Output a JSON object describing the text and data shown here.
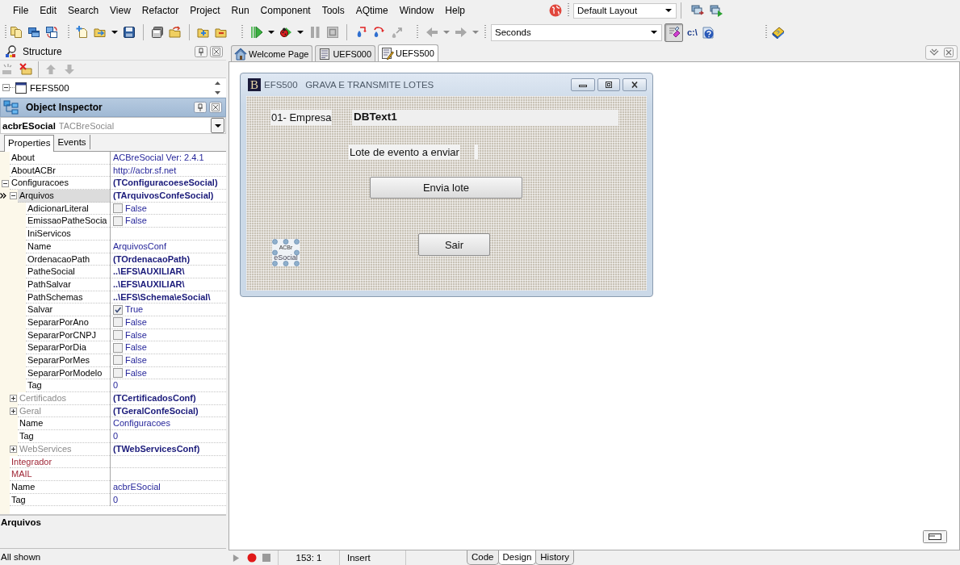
{
  "menu": {
    "items": [
      "File",
      "Edit",
      "Search",
      "View",
      "Refactor",
      "Project",
      "Run",
      "Component",
      "Tools",
      "AQtime",
      "Window",
      "Help"
    ],
    "layout_combo": {
      "value": "Default Layout"
    }
  },
  "toolbar": {
    "time_combo": {
      "value": "Seconds"
    },
    "toggle_button": {
      "on": true
    },
    "path_button": "c:\\"
  },
  "structure": {
    "title": "Structure",
    "tree": [
      {
        "label": "FEFS500",
        "expanded": true
      }
    ]
  },
  "object_inspector": {
    "title": "Object Inspector",
    "component": {
      "name": "acbrESocial",
      "class": "TACBreSocial"
    },
    "tabs": [
      {
        "label": "Properties",
        "selected": true
      },
      {
        "label": "Events",
        "selected": false
      }
    ],
    "properties": [
      {
        "name": "About",
        "value": "ACBreSocial Ver: 2.4.1",
        "kind": "text",
        "selected": false
      },
      {
        "name": "AboutACBr",
        "value": "http://acbr.sf.net",
        "kind": "text",
        "selected": false
      },
      {
        "name": "Configuracoes",
        "value": "(TConfiguracoeseSocial)",
        "kind": "changed",
        "selected": false,
        "expanded": true,
        "children": [
          {
            "name": "Arquivos",
            "value": "(TArquivosConfeSocial)",
            "kind": "changed",
            "selected": true,
            "expanded": true,
            "children": [
              {
                "name": "AdicionarLiteral",
                "value": "False",
                "kind": "bool",
                "checked": false,
                "selected": false
              },
              {
                "name": "EmissaoPatheSocia",
                "value": "False",
                "kind": "bool",
                "checked": false,
                "selected": false
              },
              {
                "name": "IniServicos",
                "kind": "text",
                "selected": false
              },
              {
                "name": "Name",
                "value": "ArquivosConf",
                "kind": "text",
                "selected": false
              },
              {
                "name": "OrdenacaoPath",
                "value": "(TOrdenacaoPath)",
                "kind": "changed",
                "selected": false
              },
              {
                "name": "PatheSocial",
                "value": "..\\EFS\\AUXILIAR\\",
                "kind": "changed",
                "selected": false
              },
              {
                "name": "PathSalvar",
                "value": "..\\EFS\\AUXILIAR\\",
                "kind": "changed",
                "selected": false
              },
              {
                "name": "PathSchemas",
                "value": "..\\EFS\\Schema\\eSocial\\",
                "kind": "changed",
                "selected": false
              },
              {
                "name": "Salvar",
                "value": "True",
                "kind": "bool",
                "checked": true,
                "selected": false
              },
              {
                "name": "SepararPorAno",
                "value": "False",
                "kind": "bool",
                "checked": false,
                "selected": false
              },
              {
                "name": "SepararPorCNPJ",
                "value": "False",
                "kind": "bool",
                "checked": false,
                "selected": false
              },
              {
                "name": "SepararPorDia",
                "value": "False",
                "kind": "bool",
                "checked": false,
                "selected": false
              },
              {
                "name": "SepararPorMes",
                "value": "False",
                "kind": "bool",
                "checked": false,
                "selected": false
              },
              {
                "name": "SepararPorModelo",
                "value": "False",
                "kind": "bool",
                "checked": false,
                "selected": false
              },
              {
                "name": "Tag",
                "value": "0",
                "kind": "text",
                "selected": false
              }
            ]
          },
          {
            "name": "Certificados",
            "value": "(TCertificadosConf)",
            "kind": "changed",
            "selected": false,
            "expanded": false
          },
          {
            "name": "Geral",
            "value": "(TGeralConfeSocial)",
            "kind": "changed",
            "selected": false,
            "expanded": false
          },
          {
            "name": "Name",
            "value": "Configuracoes",
            "kind": "text",
            "selected": false
          },
          {
            "name": "Tag",
            "value": "0",
            "kind": "text",
            "selected": false
          },
          {
            "name": "WebServices",
            "value": "(TWebServicesConf)",
            "kind": "changed",
            "selected": false,
            "expanded": false
          }
        ]
      },
      {
        "name": "Integrador",
        "kind": "reference",
        "selected": false
      },
      {
        "name": "MAIL",
        "kind": "reference",
        "selected": false
      },
      {
        "name": "Name",
        "value": "acbrESocial",
        "kind": "text",
        "selected": false
      },
      {
        "name": "Tag",
        "value": "0",
        "kind": "text",
        "selected": false
      }
    ],
    "description": "Arquivos",
    "status": "All shown"
  },
  "editor": {
    "tabs": [
      {
        "label": "Welcome Page",
        "kind": "home",
        "selected": false
      },
      {
        "label": "UEFS000",
        "kind": "unit",
        "selected": false
      },
      {
        "label": "UEFS500",
        "kind": "form",
        "selected": true
      }
    ],
    "form": {
      "icon_letter": "B",
      "title": "EFS500   GRAVA E TRANSMITE LOTES",
      "controls": [
        {
          "kind": "label",
          "text": "01- Empresa",
          "selected": false
        },
        {
          "kind": "dbtext",
          "text": "DBText1",
          "selected": false
        },
        {
          "kind": "label",
          "text": "Lote de evento a enviar",
          "selected": false
        },
        {
          "kind": "blank",
          "selected": false
        },
        {
          "kind": "button",
          "text": "Envia lote",
          "selected": false
        },
        {
          "kind": "button",
          "text": "Sair",
          "selected": false
        },
        {
          "kind": "component",
          "captions": [
            "ACBr",
            "eSocial"
          ],
          "selected": true
        }
      ]
    },
    "status_bar": {
      "position": "153: 1",
      "mode": "Insert",
      "view_tabs": [
        {
          "label": "Code",
          "selected": false
        },
        {
          "label": "Design",
          "selected": true
        },
        {
          "label": "History",
          "selected": false
        }
      ]
    }
  }
}
